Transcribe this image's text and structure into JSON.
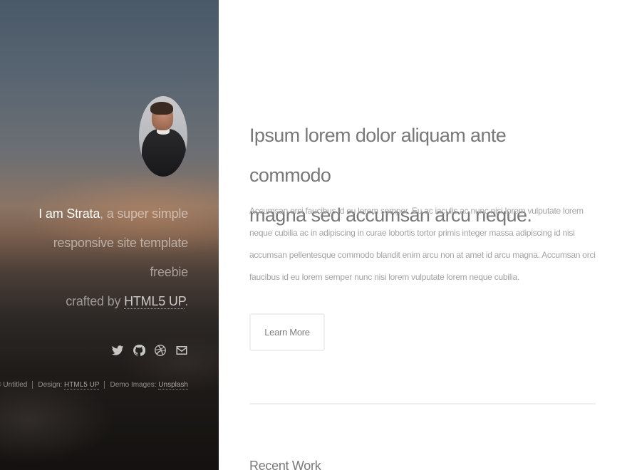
{
  "header": {
    "intro": {
      "prefix_strong": "I am Strata",
      "line1_rest": ", a super simple",
      "line2": "responsive site template freebie",
      "line3_prefix": "crafted by ",
      "line3_link": "HTML5 UP",
      "line3_suffix": "."
    },
    "social_icons": [
      "twitter-icon",
      "github-icon",
      "dribbble-icon",
      "envelope-icon"
    ],
    "copyright": {
      "item1": "© Untitled",
      "item2_label": "Design: ",
      "item2_link": "HTML5 UP",
      "item3_label": "Demo Images: ",
      "item3_link": "Unsplash"
    }
  },
  "main": {
    "title_line1": "Ipsum lorem dolor aliquam ante commodo",
    "title_line2": "magna sed accumsan arcu neque.",
    "paragraph": "Accumsan orci faucibus id eu lorem semper. Eu ac iaculis ac nunc nisi lorem vulputate lorem neque cubilia ac in adipiscing in curae lobortis tortor primis integer massa adipiscing id nisi accumsan pellentesque commodo blandit enim arcu non at amet id arcu magna. Accumsan orci faucibus id eu lorem semper nunc nisi lorem vulputate lorem neque cubilia.",
    "button_label": "Learn More",
    "section_title": "Recent Work"
  }
}
